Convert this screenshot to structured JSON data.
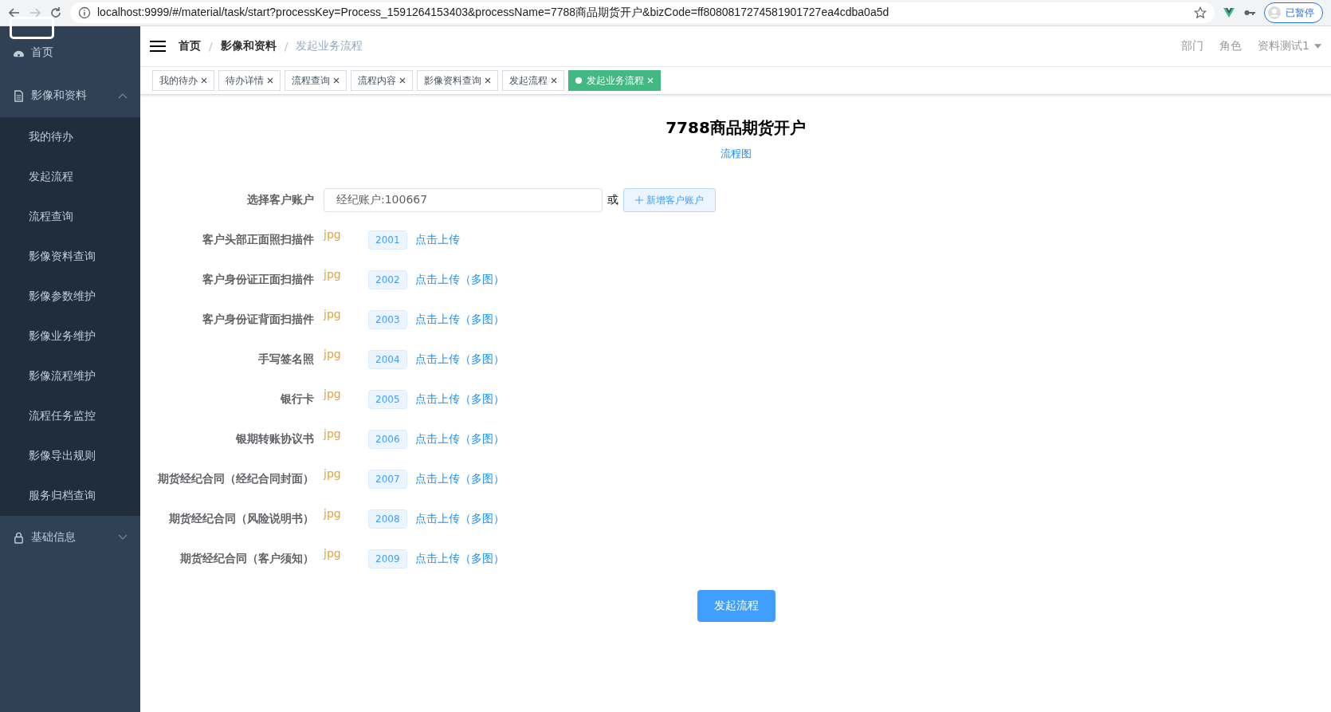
{
  "browser": {
    "url": "localhost:9999/#/material/task/start?processKey=Process_1591264153403&processName=7788商品期货开户&bizCode=ff8080817274581901727ea4cdba0a5d",
    "profile": "已暂停"
  },
  "sidebar": {
    "items": [
      {
        "label": "首页"
      },
      {
        "label": "影像和资料",
        "expanded": true,
        "children": [
          {
            "label": "我的待办"
          },
          {
            "label": "发起流程"
          },
          {
            "label": "流程查询"
          },
          {
            "label": "影像资料查询"
          },
          {
            "label": "影像参数维护"
          },
          {
            "label": "影像业务维护"
          },
          {
            "label": "影像流程维护"
          },
          {
            "label": "流程任务监控"
          },
          {
            "label": "影像导出规则"
          },
          {
            "label": "服务归档查询"
          }
        ]
      },
      {
        "label": "基础信息",
        "expanded": false
      }
    ]
  },
  "breadcrumb": [
    {
      "label": "首页",
      "current": false
    },
    {
      "separator": "/",
      "label": "影像和资料",
      "current": false
    },
    {
      "separator": "/",
      "label": "发起业务流程",
      "current": true
    }
  ],
  "header_menu": [
    {
      "label": "部门",
      "dropdown": false
    },
    {
      "label": "角色",
      "dropdown": false
    },
    {
      "label": "资料测试1",
      "dropdown": true
    }
  ],
  "tabs": [
    {
      "label": "我的待办",
      "selected": false
    },
    {
      "label": "待办详情",
      "selected": false
    },
    {
      "label": "流程查询",
      "selected": false
    },
    {
      "label": "流程内容",
      "selected": false
    },
    {
      "label": "影像资料查询",
      "selected": false
    },
    {
      "label": "发起流程",
      "selected": false
    },
    {
      "label": "发起业务流程",
      "selected": true
    }
  ],
  "form": {
    "title": "7788商品期货开户",
    "diagram_link": "流程图",
    "account": {
      "label": "选择客户账户",
      "value": "经纪账户:100667",
      "or": "或",
      "add_button": "新增客户账户"
    },
    "files": [
      {
        "label": "客户头部正面照扫描件",
        "type": "jpg",
        "code": "2001",
        "action": "点击上传"
      },
      {
        "label": "客户身份证正面扫描件",
        "type": "jpg",
        "code": "2002",
        "action": "点击上传（多图）"
      },
      {
        "label": "客户身份证背面扫描件",
        "type": "jpg",
        "code": "2003",
        "action": "点击上传（多图）"
      },
      {
        "label": "手写签名照",
        "type": "jpg",
        "code": "2004",
        "action": "点击上传（多图）"
      },
      {
        "label": "银行卡",
        "type": "jpg",
        "code": "2005",
        "action": "点击上传（多图）"
      },
      {
        "label": "银期转账协议书",
        "type": "jpg",
        "code": "2006",
        "action": "点击上传（多图）"
      },
      {
        "label": "期货经纪合同（经纪合同封面）",
        "type": "jpg",
        "code": "2007",
        "action": "点击上传（多图）"
      },
      {
        "label": "期货经纪合同（风险说明书）",
        "type": "jpg",
        "code": "2008",
        "action": "点击上传（多图）"
      },
      {
        "label": "期货经纪合同（客户须知）",
        "type": "jpg",
        "code": "2009",
        "action": "点击上传（多图）"
      }
    ],
    "submit": "发起流程"
  }
}
